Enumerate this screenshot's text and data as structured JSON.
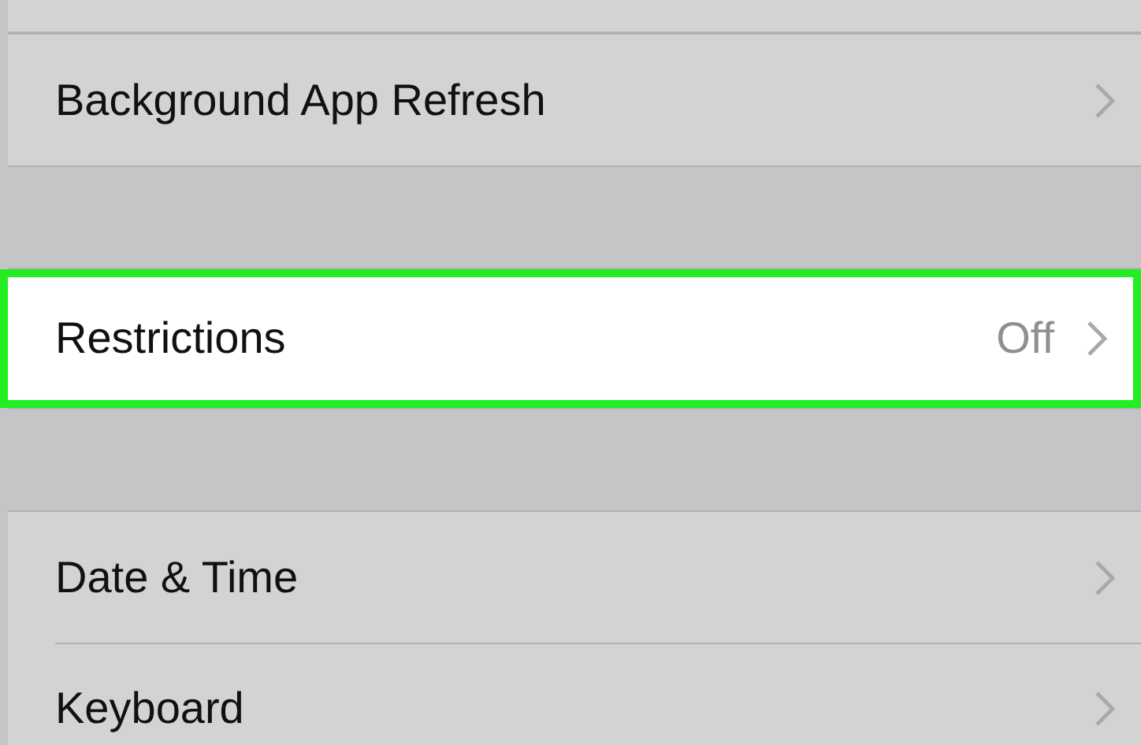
{
  "sections": [
    {
      "rows": [
        {
          "label": "Background App Refresh",
          "highlighted": false
        }
      ]
    },
    {
      "rows": [
        {
          "label": "Restrictions",
          "value": "Off",
          "highlighted": true
        }
      ]
    },
    {
      "rows": [
        {
          "label": "Date & Time",
          "highlighted": false
        },
        {
          "label": "Keyboard",
          "highlighted": false
        }
      ]
    }
  ]
}
